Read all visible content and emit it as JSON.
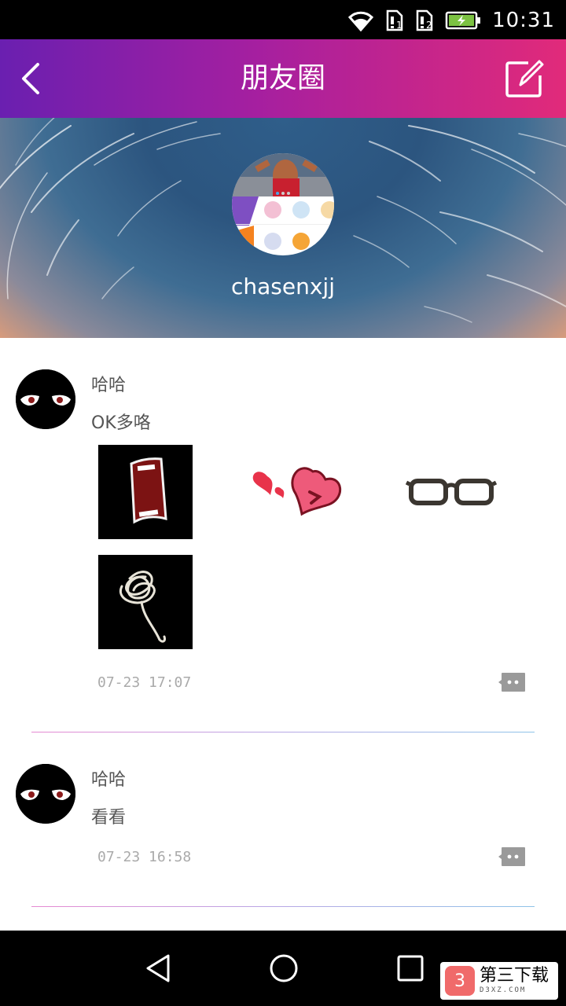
{
  "status_bar": {
    "time": "10:31",
    "icons": [
      "wifi-icon",
      "sim1-alert-icon",
      "sim2-alert-icon",
      "battery-charging-icon"
    ]
  },
  "header": {
    "title": "朋友圈",
    "back_icon": "chevron-left-icon",
    "compose_icon": "compose-edit-icon"
  },
  "profile": {
    "username": "chasenxjj"
  },
  "posts": [
    {
      "author": "哈哈",
      "text": "OK多咯",
      "time": "07-23  17:07",
      "images": [
        "red-mouth-sticker",
        "heart-sticker",
        "glasses-sticker",
        "scribble-sticker"
      ]
    },
    {
      "author": "哈哈",
      "text": "看看",
      "time": "07-23  16:58",
      "images": []
    }
  ],
  "nav": {
    "back": "nav-back-icon",
    "home": "nav-home-icon",
    "recents": "nav-recents-icon"
  },
  "watermark": {
    "logo": "3",
    "main": "第三下载",
    "sub": "D3XZ.COM"
  }
}
